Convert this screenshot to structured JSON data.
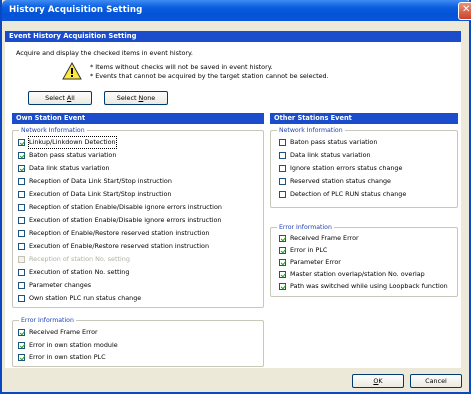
{
  "window": {
    "title": "History Acquisition Setting",
    "close_glyph": "✕"
  },
  "main_header": "Event History Acquisition Setting",
  "description": "Acquire and display the checked items in event history.",
  "notes": [
    "* Items without checks will not be saved in event history.",
    "* Events that cannot be acquired by the target station cannot be selected."
  ],
  "buttons": {
    "select_all_prefix": "Select ",
    "select_all_key": "A",
    "select_all_suffix": "ll",
    "select_none_prefix": "Select ",
    "select_none_key": "N",
    "select_none_suffix": "one",
    "ok_key": "O",
    "ok_suffix": "K",
    "cancel": "Cancel"
  },
  "own_station": {
    "header": "Own Station Event",
    "network_group": {
      "label": "Network Information",
      "items": [
        {
          "label": "Linkup/Linkdown Detection",
          "checked": true,
          "enabled": true,
          "focused": true
        },
        {
          "label": "Baton pass status variation",
          "checked": true,
          "enabled": true
        },
        {
          "label": "Data link status variation",
          "checked": true,
          "enabled": true
        },
        {
          "label": "Reception of Data Link Start/Stop instruction",
          "checked": false,
          "enabled": true
        },
        {
          "label": "Execution of Data Link Start/Stop instruction",
          "checked": false,
          "enabled": true
        },
        {
          "label": "Reception of station Enable/Disable ignore errors instruction",
          "checked": false,
          "enabled": true
        },
        {
          "label": "Execution of station Enable/Disable ignore errors instruction",
          "checked": false,
          "enabled": true
        },
        {
          "label": "Reception of Enable/Restore reserved station instruction",
          "checked": false,
          "enabled": true
        },
        {
          "label": "Execution of Enable/Restore reserved station instruction",
          "checked": false,
          "enabled": true
        },
        {
          "label": "Reception of station No. setting",
          "checked": false,
          "enabled": false
        },
        {
          "label": "Execution of station No. setting",
          "checked": false,
          "enabled": true
        },
        {
          "label": "Parameter changes",
          "checked": false,
          "enabled": true
        },
        {
          "label": "Own station PLC run status change",
          "checked": false,
          "enabled": true
        }
      ]
    },
    "error_group": {
      "label": "Error Information",
      "items": [
        {
          "label": "Received Frame Error",
          "checked": true,
          "enabled": true
        },
        {
          "label": "Error in own station module",
          "checked": true,
          "enabled": true
        },
        {
          "label": "Error in own station PLC",
          "checked": true,
          "enabled": true
        }
      ]
    }
  },
  "other_stations": {
    "header": "Other Stations Event",
    "network_group": {
      "label": "Network Information",
      "items": [
        {
          "label": "Baton pass status variation",
          "checked": false,
          "enabled": true
        },
        {
          "label": "Data link status variation",
          "checked": false,
          "enabled": true
        },
        {
          "label": "Ignore station errors status change",
          "checked": false,
          "enabled": true
        },
        {
          "label": "Reserved station status change",
          "checked": false,
          "enabled": true
        },
        {
          "label": "Detection of PLC RUN status change",
          "checked": false,
          "enabled": true
        }
      ]
    },
    "error_group": {
      "label": "Error Information",
      "items": [
        {
          "label": "Received Frame Error",
          "checked": true,
          "enabled": true
        },
        {
          "label": "Error in PLC",
          "checked": true,
          "enabled": true
        },
        {
          "label": "Parameter Error",
          "checked": true,
          "enabled": true
        },
        {
          "label": "Master station overlap/station No. overlap",
          "checked": true,
          "enabled": true
        },
        {
          "label": "Path was switched while using Loopback function",
          "checked": true,
          "enabled": true
        }
      ]
    }
  },
  "colors": {
    "title_bar": "#0a5ee0",
    "section_header": "#1a4ccc",
    "group_label": "#1f42b8",
    "check_mark": "#21a121"
  }
}
